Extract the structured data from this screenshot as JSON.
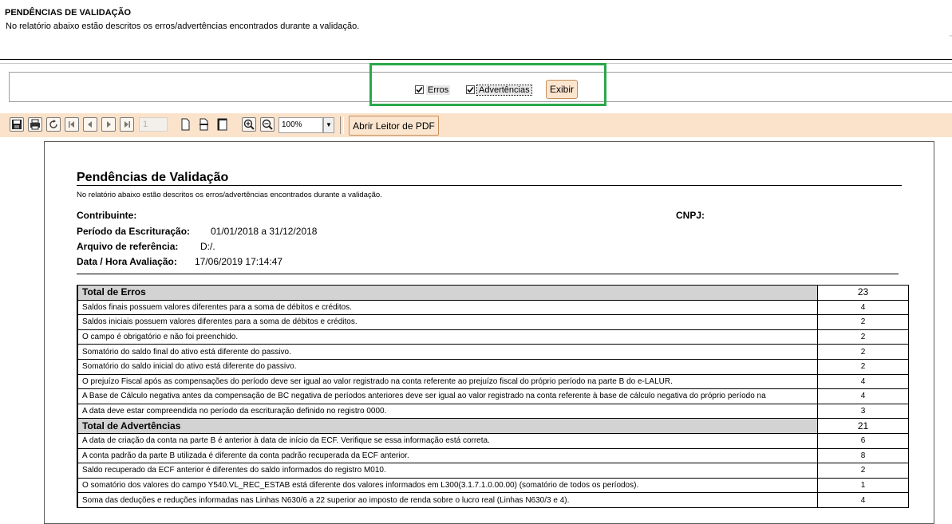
{
  "header": {
    "title": "PENDÊNCIAS DE VALIDAÇÃO",
    "description": "No relatório abaixo estão descritos os erros/advertências encontrados durante a validação."
  },
  "filters": {
    "errors_label": "Erros",
    "errors_checked": true,
    "warnings_label": "Advertências",
    "warnings_checked": true,
    "show_button": "Exibir",
    "highlight_color": "#2aa84a"
  },
  "toolbar": {
    "icons": [
      "save-icon",
      "print-icon",
      "refresh-icon",
      "first-page-icon",
      "prev-page-icon",
      "next-page-icon",
      "last-page-icon",
      "page-view-icon",
      "page-width-icon",
      "whole-page-icon",
      "zoom-in-icon",
      "zoom-out-icon"
    ],
    "page_number": "1",
    "zoom": "100%",
    "open_pdf_button": "Abrir Leitor de PDF",
    "background_color": "#fbe3cb"
  },
  "report": {
    "title": "Pendências de Validação",
    "description": "No relatório abaixo estão descritos os erros/advertências encontrados durante a validação.",
    "contribuinte_label": "Contribuinte:",
    "cnpj_label": "CNPJ:",
    "periodo_label": "Período da Escrituração:",
    "periodo_value": "01/01/2018 a 31/12/2018",
    "arquivo_label": "Arquivo de referência:",
    "arquivo_value": "D:/.",
    "data_label": "Data / Hora Avaliação:",
    "data_value": "17/06/2019 17:14:47",
    "errors_total_label": "Total de Erros",
    "errors_total": "23",
    "errors": [
      {
        "text": "Saldos finais possuem valores diferentes para a soma de débitos e créditos.",
        "count": "4"
      },
      {
        "text": "Saldos iniciais possuem valores diferentes para a soma de débitos e créditos.",
        "count": "2"
      },
      {
        "text": "O campo é obrigatório e não foi preenchido.",
        "count": "2"
      },
      {
        "text": "Somatório do saldo final do ativo está diferente do passivo.",
        "count": "2"
      },
      {
        "text": "Somatório do saldo inicial do ativo está diferente do passivo.",
        "count": "2"
      },
      {
        "text": "O prejuízo Fiscal após as compensações do período deve ser igual ao valor registrado na conta referente ao prejuízo fiscal do próprio período na parte B do e-LALUR.",
        "count": "4"
      },
      {
        "text": "A Base de Cálculo negativa antes da compensação de BC negativa de períodos anteriores deve ser igual ao valor registrado na conta referente à base de cálculo negativa do próprio período na",
        "count": "4"
      },
      {
        "text": "A data deve estar compreendida no período da escrituração definido no registro 0000.",
        "count": "3"
      }
    ],
    "warnings_total_label": "Total de Advertências",
    "warnings_total": "21",
    "warnings": [
      {
        "text": "A data de criação da conta na parte B é anterior à data de início da ECF. Verifique se essa informação está correta.",
        "count": "6"
      },
      {
        "text": "A conta padrão da parte B utilizada é diferente da conta padrão recuperada da ECF anterior.",
        "count": "8"
      },
      {
        "text": "Saldo recuperado da ECF anterior é diferentes do saldo informados do registro M010.",
        "count": "2"
      },
      {
        "text": "O somatório dos valores do campo Y540.VL_REC_ESTAB está diferente dos valores informados em L300(3.1.7.1.0.00.00) (somatório de todos os períodos).",
        "count": "1"
      },
      {
        "text": "Soma das deduções e reduções informadas nas Linhas N630/6 a 22 superior ao imposto de renda sobre o lucro real (Linhas N630/3 e 4).",
        "count": "4"
      }
    ]
  }
}
